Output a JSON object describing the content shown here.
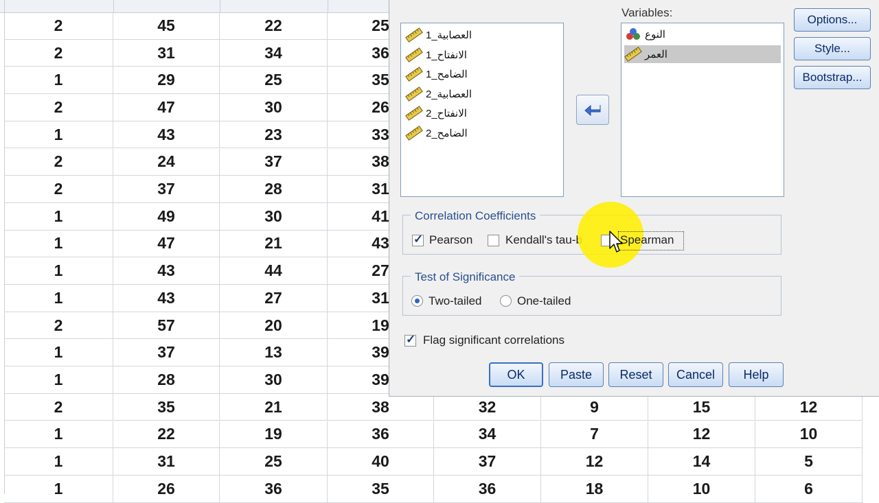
{
  "grid": {
    "rows": [
      [
        "2",
        "45",
        "22",
        "25"
      ],
      [
        "2",
        "31",
        "34",
        "36"
      ],
      [
        "1",
        "29",
        "25",
        "35"
      ],
      [
        "2",
        "47",
        "30",
        "26"
      ],
      [
        "1",
        "43",
        "23",
        "33"
      ],
      [
        "2",
        "24",
        "37",
        "38"
      ],
      [
        "2",
        "37",
        "28",
        "31"
      ],
      [
        "1",
        "49",
        "30",
        "41"
      ],
      [
        "1",
        "47",
        "21",
        "43"
      ],
      [
        "1",
        "43",
        "44",
        "27"
      ],
      [
        "1",
        "43",
        "27",
        "31"
      ],
      [
        "2",
        "57",
        "20",
        "19"
      ],
      [
        "1",
        "37",
        "13",
        "39"
      ],
      [
        "1",
        "28",
        "30",
        "39"
      ],
      [
        "2",
        "35",
        "21",
        "38",
        "32",
        "9",
        "15",
        "12"
      ],
      [
        "1",
        "22",
        "19",
        "36",
        "34",
        "7",
        "12",
        "10"
      ],
      [
        "1",
        "31",
        "25",
        "40",
        "37",
        "12",
        "14",
        "5"
      ],
      [
        "1",
        "26",
        "36",
        "35",
        "36",
        "18",
        "10",
        "6"
      ]
    ]
  },
  "dialog": {
    "source_vars": [
      "العصابية_1",
      "الانفتاح_1",
      "الضامح_1",
      "العصابية_2",
      "الانفتاح_2",
      "الضامح_2"
    ],
    "variables_label": "Variables:",
    "target_vars": [
      {
        "label": "النوع",
        "icon": "nominal-icon"
      },
      {
        "label": "العمر",
        "icon": "scale-ruler-icon",
        "selected": true
      }
    ],
    "buttons": {
      "options": "Options...",
      "style": "Style...",
      "bootstrap": "Bootstrap..."
    },
    "correlation": {
      "legend": "Correlation Coefficients",
      "pearson": "Pearson",
      "pearson_checked": true,
      "kendall": "Kendall's tau-b",
      "kendall_checked": false,
      "spearman": "Spearman",
      "spearman_checked": false
    },
    "significance": {
      "legend": "Test of Significance",
      "two": "Two-tailed",
      "one": "One-tailed",
      "selected": "Two-tailed"
    },
    "flag": {
      "label": "Flag significant correlations",
      "checked": true
    },
    "bottom": {
      "ok": "OK",
      "paste": "Paste",
      "reset": "Reset",
      "cancel": "Cancel",
      "help": "Help"
    }
  }
}
